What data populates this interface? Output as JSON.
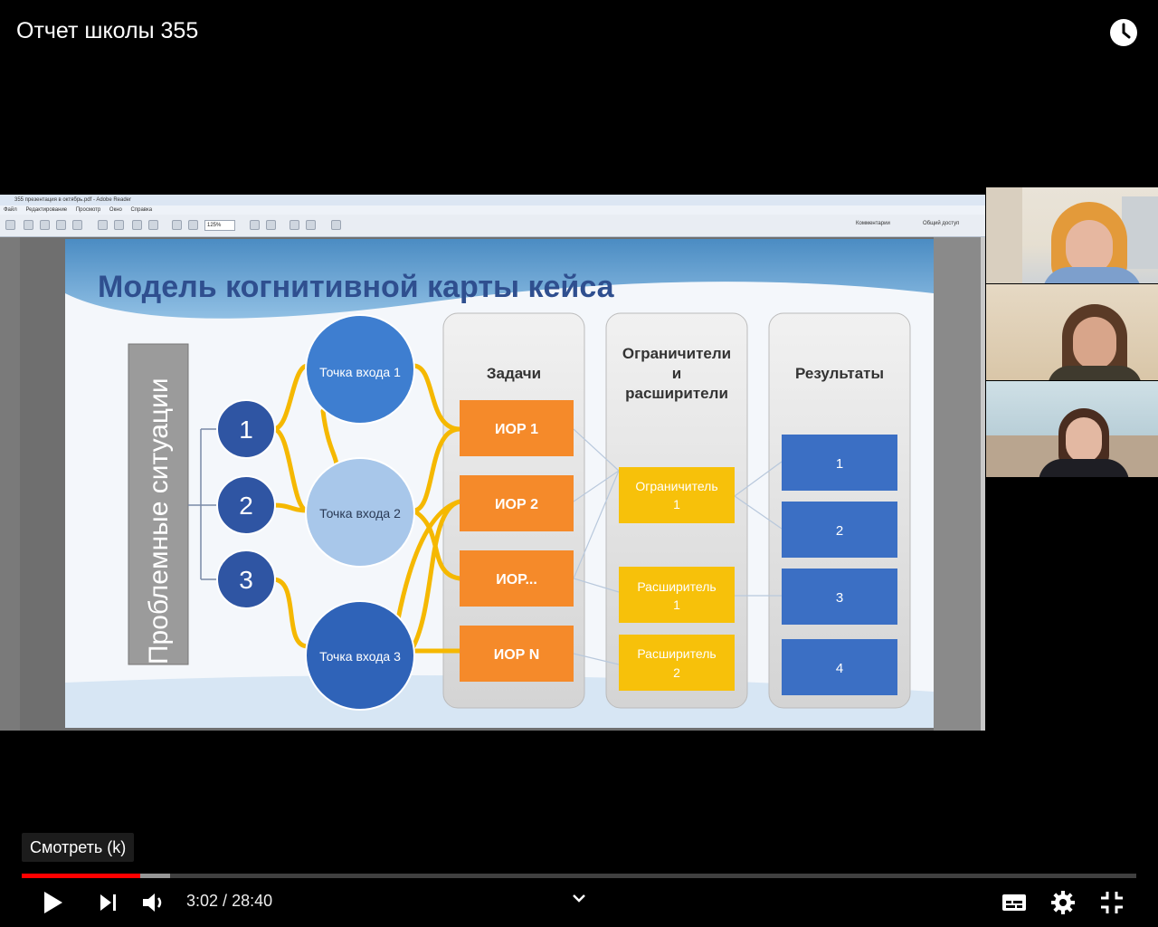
{
  "video": {
    "title": "Отчет школы 355",
    "watch_later_label": "Смотреть (k)",
    "current_time": "3:02",
    "time_separator": " / ",
    "duration": "28:40",
    "progress_played_fraction": 0.106,
    "progress_buffered_fraction": 0.133
  },
  "viewer_window": {
    "title_text": "355 презентация в октябрь.pdf - Adobe Reader",
    "menu": [
      "Файл",
      "Редактирование",
      "Просмотр",
      "Окно",
      "Справка"
    ],
    "zoom": "125%",
    "right_buttons": [
      "Комментарии",
      "Общий доступ"
    ]
  },
  "slide": {
    "title": "Модель когнитивной карты кейса",
    "problem_label": "Проблемные ситуации",
    "numbers": [
      "1",
      "2",
      "3"
    ],
    "entry_points": [
      "Точка входа 1",
      "Точка входа 2",
      "Точка входа 3"
    ],
    "columns": {
      "tasks": {
        "header": "Задачи",
        "items": [
          "ИОР 1",
          "ИОР 2",
          "ИОР...",
          "ИОР N"
        ]
      },
      "limiters": {
        "header_lines": [
          "Ограничители",
          "и",
          "расширители"
        ],
        "items": [
          {
            "line1": "Ограничитель",
            "line2": "1"
          },
          {
            "line1": "Расширитель",
            "line2": "1"
          },
          {
            "line1": "Расширитель",
            "line2": "2"
          }
        ]
      },
      "results": {
        "header": "Результаты",
        "items": [
          "1",
          "2",
          "3",
          "4"
        ]
      }
    }
  },
  "colors": {
    "dark_blue": "#2f55a3",
    "light_blue_circle": "#a8c7ea",
    "mid_blue_circle": "#3e7ed0",
    "orange": "#f58a2a",
    "yellow": "#f7c10a",
    "result_blue": "#3b6fc4",
    "connector": "#f5b800",
    "progress_red": "#ff0000"
  },
  "icons": [
    "clock-icon",
    "play-icon",
    "next-icon",
    "volume-icon",
    "chevron-down-icon",
    "subtitles-icon",
    "settings-icon",
    "exit-fullscreen-icon"
  ]
}
